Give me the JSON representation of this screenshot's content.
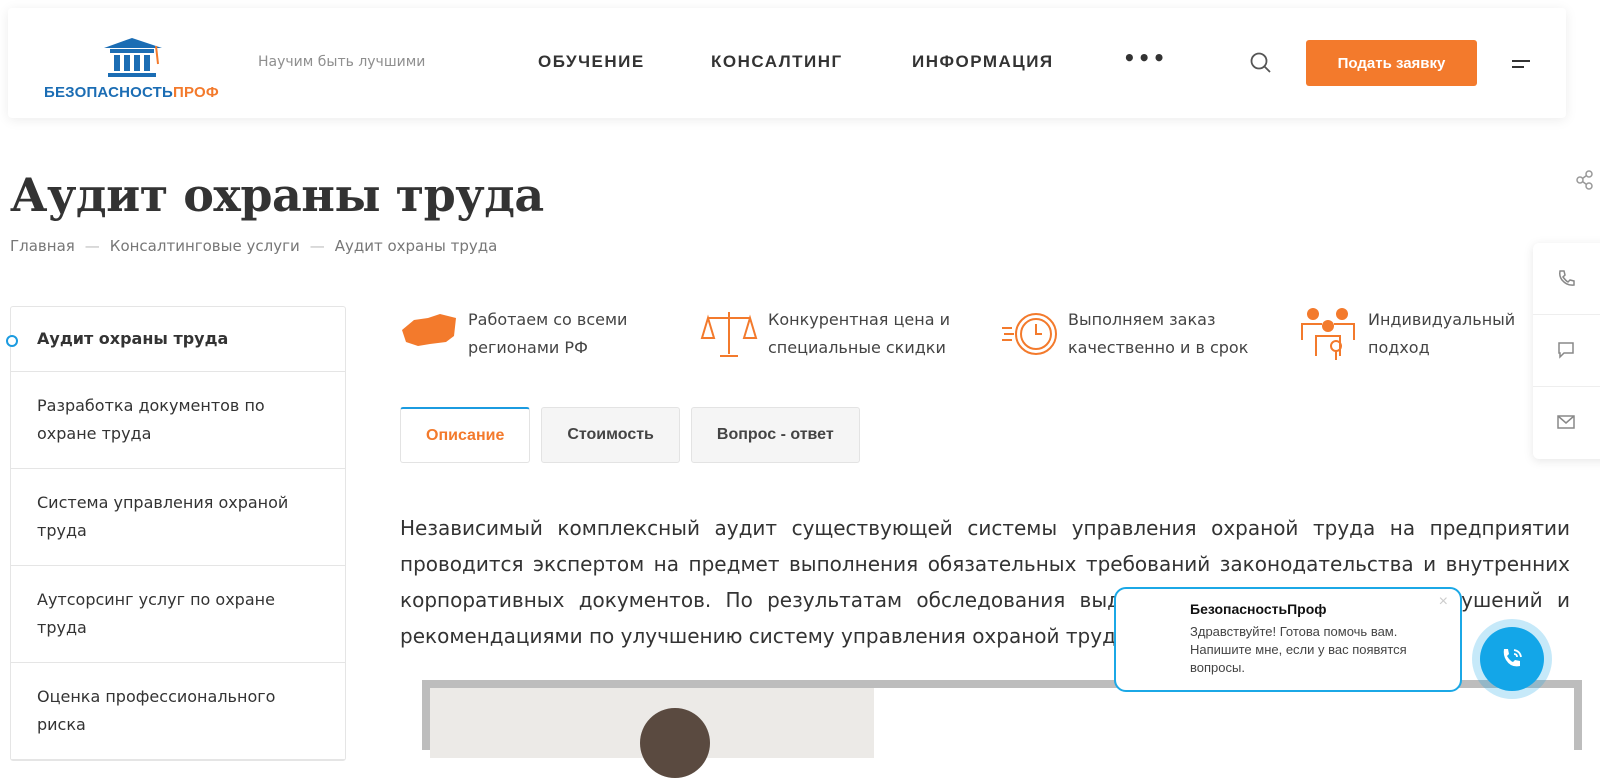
{
  "header": {
    "logo_main": "БЕЗОПАСНОСТЬ",
    "logo_accent": "ПРОФ",
    "slogan": "Научим быть лучшими",
    "nav": [
      "ОБУЧЕНИЕ",
      "КОНСАЛТИНГ",
      "ИНФОРМАЦИЯ"
    ],
    "more": "•••",
    "cta": "Подать заявку"
  },
  "page": {
    "title": "Аудит охраны труда",
    "breadcrumbs": [
      "Главная",
      "Консалтинговые услуги",
      "Аудит охраны труда"
    ],
    "sep": "—"
  },
  "sidebar": {
    "items": [
      "Аудит охраны труда",
      "Разработка документов по охране труда",
      "Система управления охраной труда",
      "Аутсорсинг услуг по охране труда",
      "Оценка профессионального риска"
    ]
  },
  "features": [
    {
      "icon": "russia-map-icon",
      "text": "Работаем со всеми регионами РФ"
    },
    {
      "icon": "scales-icon",
      "text": "Конкурентная цена и специальные скидки"
    },
    {
      "icon": "clock-icon",
      "text": "Выполняем заказ качественно и в срок"
    },
    {
      "icon": "people-icon",
      "text": "Индивидуальный подход"
    }
  ],
  "tabs": [
    "Описание",
    "Стоимость",
    "Вопрос - ответ"
  ],
  "description": "Независимый комплексный аудит существующей системы управления охраной труда на предприятии проводится экспертом на предмет выполнения обязательных требований законодательства и внутренних корпоративных документов. По результатам обследования выдается отчет с описанием нарушений и рекомендациями по улучшению систему управления охраной труда.",
  "chat": {
    "name": "БезопасностьПроф",
    "message": "Здравствуйте! Готова помочь вам. Напишите мне, если у вас появятся вопросы.",
    "close": "×"
  },
  "colors": {
    "accent": "#f37a2c",
    "brand": "#1b6db4",
    "chat": "#13a6e8"
  }
}
